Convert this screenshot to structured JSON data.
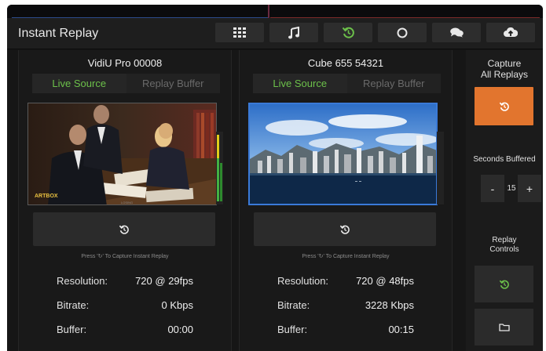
{
  "app": {
    "title": "Instant Replay"
  },
  "toolbar": [
    {
      "icon": "grid-icon"
    },
    {
      "icon": "music-icon"
    },
    {
      "icon": "replay-icon",
      "active": true
    },
    {
      "icon": "record-circle-icon"
    },
    {
      "icon": "chat-icon"
    },
    {
      "icon": "cloud-upload-icon"
    }
  ],
  "colors": {
    "accent_green": "#6cc04a",
    "capture_orange": "#e2752e",
    "bg": "#161616"
  },
  "panels": [
    {
      "title": "VidiU Pro 00008",
      "tabs": [
        "Live Source",
        "Replay Buffer"
      ],
      "active_tab": "Live Source",
      "hint": "Press '↻' To Capture Instant Replay",
      "stats": [
        {
          "label": "Resolution:",
          "value": "720 @ 29fps"
        },
        {
          "label": "Bitrate:",
          "value": "0 Kbps"
        },
        {
          "label": "Buffer:",
          "value": "00:00"
        }
      ]
    },
    {
      "title": "Cube 655 54321",
      "tabs": [
        "Live Source",
        "Replay Buffer"
      ],
      "active_tab": "Live Source",
      "hint": "Press '↻' To Capture Instant Replay",
      "stats": [
        {
          "label": "Resolution:",
          "value": "720 @ 48fps"
        },
        {
          "label": "Bitrate:",
          "value": "3228 Kbps"
        },
        {
          "label": "Buffer:",
          "value": "00:15"
        }
      ]
    }
  ],
  "sidebar": {
    "capture_all_label": "Capture\nAll Replays",
    "seconds_buffered_label": "Seconds Buffered",
    "seconds_value": "15",
    "minus_label": "-",
    "plus_label": "+",
    "replay_controls_label": "Replay\nControls"
  },
  "video_overlays": {
    "logo_text": "ARTBOX",
    "sub_text": "LOSING"
  }
}
